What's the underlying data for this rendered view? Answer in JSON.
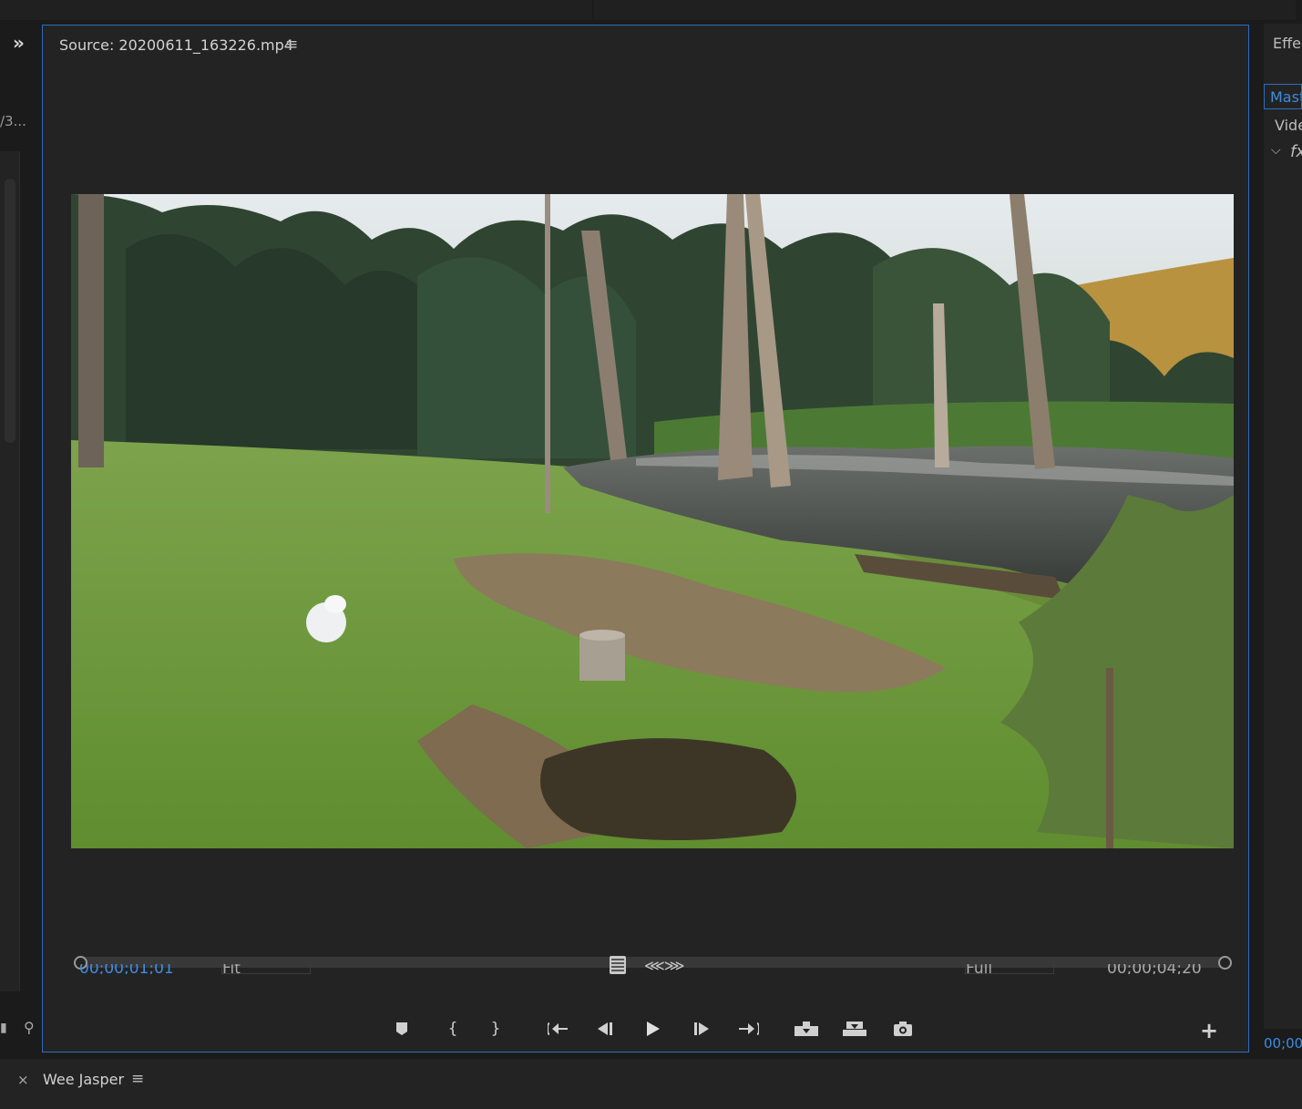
{
  "source_monitor": {
    "title": "Source: 20200611_163226.mp4",
    "menu_icon": "≡",
    "in_timecode": "00;00;01;01",
    "zoom_select": "Fit",
    "resolution_select": "Full",
    "duration_timecode": "00;00;04;20"
  },
  "left_panel": {
    "expand_icon": "»",
    "name_fragment": "/3..."
  },
  "right_panel": {
    "tab_label": "Effec",
    "master_tab": "Mast",
    "video_label": "Vide",
    "fx_label": "fx",
    "timecode": "00;00;"
  },
  "bottom_panel": {
    "close_icon": "×",
    "title": "Wee Jasper",
    "menu_icon": "≡"
  },
  "transport": {
    "add_marker": "⯂",
    "mark_in": "{",
    "mark_out": "}",
    "go_to_in": "{⇤",
    "step_back": "◀|",
    "play": "▶",
    "step_forward": "|▶",
    "go_to_out": "⇥}",
    "insert": "⊞",
    "overwrite": "⊟",
    "export_frame": "◉",
    "add_button": "+"
  },
  "colors": {
    "panel_bg": "#232323",
    "app_bg": "#1b1b1b",
    "focus_border": "#2d6cc0",
    "timecode_blue": "#3e8cdf"
  }
}
